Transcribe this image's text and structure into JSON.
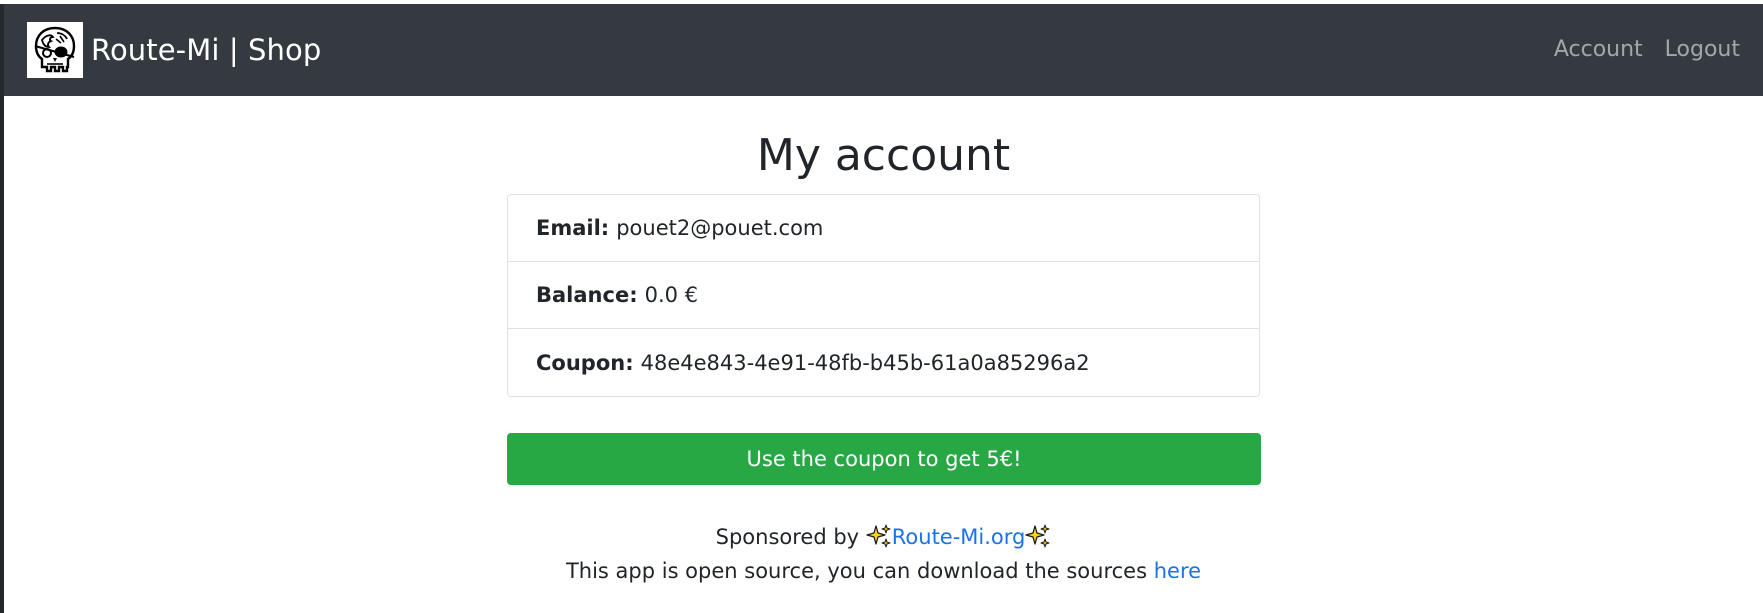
{
  "navbar": {
    "brand": "Route-Mi | Shop",
    "logo_icon": "pirate-skull-icon",
    "links": [
      {
        "label": "Account"
      },
      {
        "label": "Logout"
      }
    ]
  },
  "page": {
    "title": "My account"
  },
  "account": {
    "email_label": "Email:",
    "email_value": "pouet2@pouet.com",
    "balance_label": "Balance:",
    "balance_value": "0.0 €",
    "coupon_label": "Coupon:",
    "coupon_value": "48e4e843-4e91-48fb-b45b-61a0a85296a2"
  },
  "coupon_button": {
    "label": "Use the coupon to get 5€!",
    "color": "#28a745"
  },
  "footer": {
    "sponsored_prefix": "Sponsored by ",
    "sponsor_link": "Route-Mi.org",
    "sparkle_icon": "sparkles-icon",
    "opensource_text": "This app is open source, you can download the sources ",
    "sources_link": "here",
    "link_color": "#1a73e8"
  }
}
